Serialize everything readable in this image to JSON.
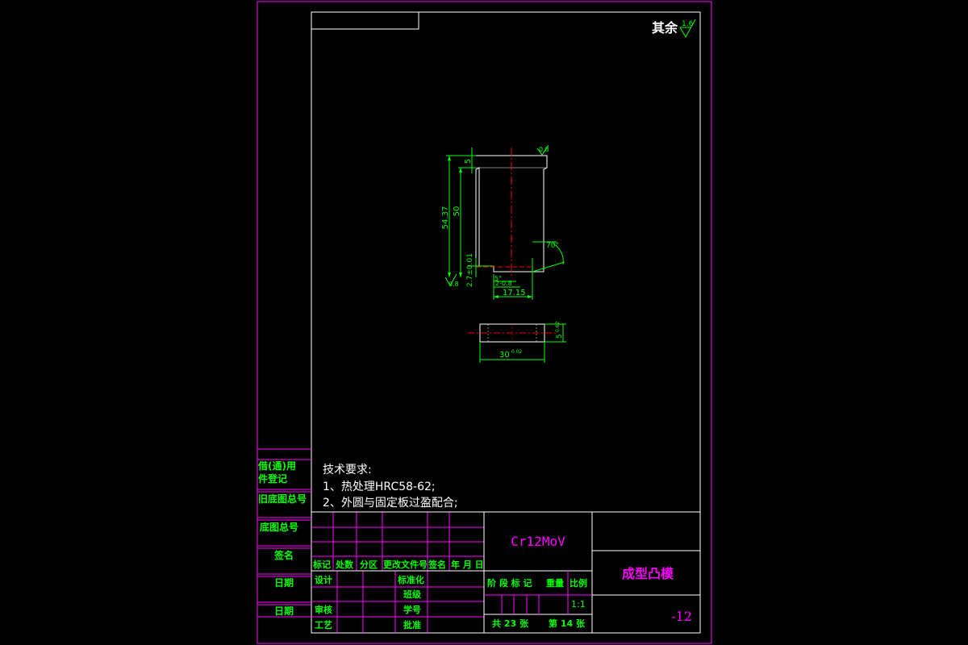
{
  "colors": {
    "background": "#000000",
    "frame": "#ff00ff",
    "border": "#ffffff",
    "dimension": "#00ff00",
    "centerline": "#ff0000",
    "text": "#ffffff",
    "title_green": "#00ff00",
    "title_magenta": "#ff00ff"
  },
  "surface_finish": {
    "label": "其余",
    "value": "1.6"
  },
  "drawing": {
    "roughness_top": "0.8",
    "roughness_bottom": "0.8",
    "dim_total_height": "54.37",
    "dim_body_height": "50",
    "dim_top_step": "5",
    "dim_flange": "2.7±0.01",
    "dim_chamfer_small": "5°",
    "dim_chamfer": "2-0.8",
    "dim_width": "17.15",
    "dim_angle": "70°",
    "dim_length": "30",
    "dim_length_tol": "0.02",
    "dim_thickness": "5",
    "dim_thickness_tol": "0.02"
  },
  "technical_requirements": {
    "title": "技术要求:",
    "items": [
      "1、热处理HRC58-62;",
      "2、外圆与固定板过盈配合;"
    ]
  },
  "side_panel": {
    "labels": [
      "借(通)用",
      "件登记",
      "旧底图总号",
      "底图总号",
      "签名",
      "日期",
      "日期"
    ]
  },
  "title_block": {
    "material": "Cr12MoV",
    "part_name": "成型凸模",
    "drawing_no": "-12",
    "revision_header": [
      "标记",
      "处数",
      "分区",
      "更改文件号",
      "签名",
      "年 月 日"
    ],
    "row_design": "设计",
    "row_standardize": "标准化",
    "row_class": "班级",
    "row_review": "审核",
    "row_student_no": "学号",
    "row_process": "工艺",
    "row_approve": "批准",
    "stage_header": [
      "阶 段 标 记",
      "重量",
      "比例"
    ],
    "scale": "1:1",
    "sheets_total": "共 23 张",
    "sheet_no": "第 14 张"
  }
}
